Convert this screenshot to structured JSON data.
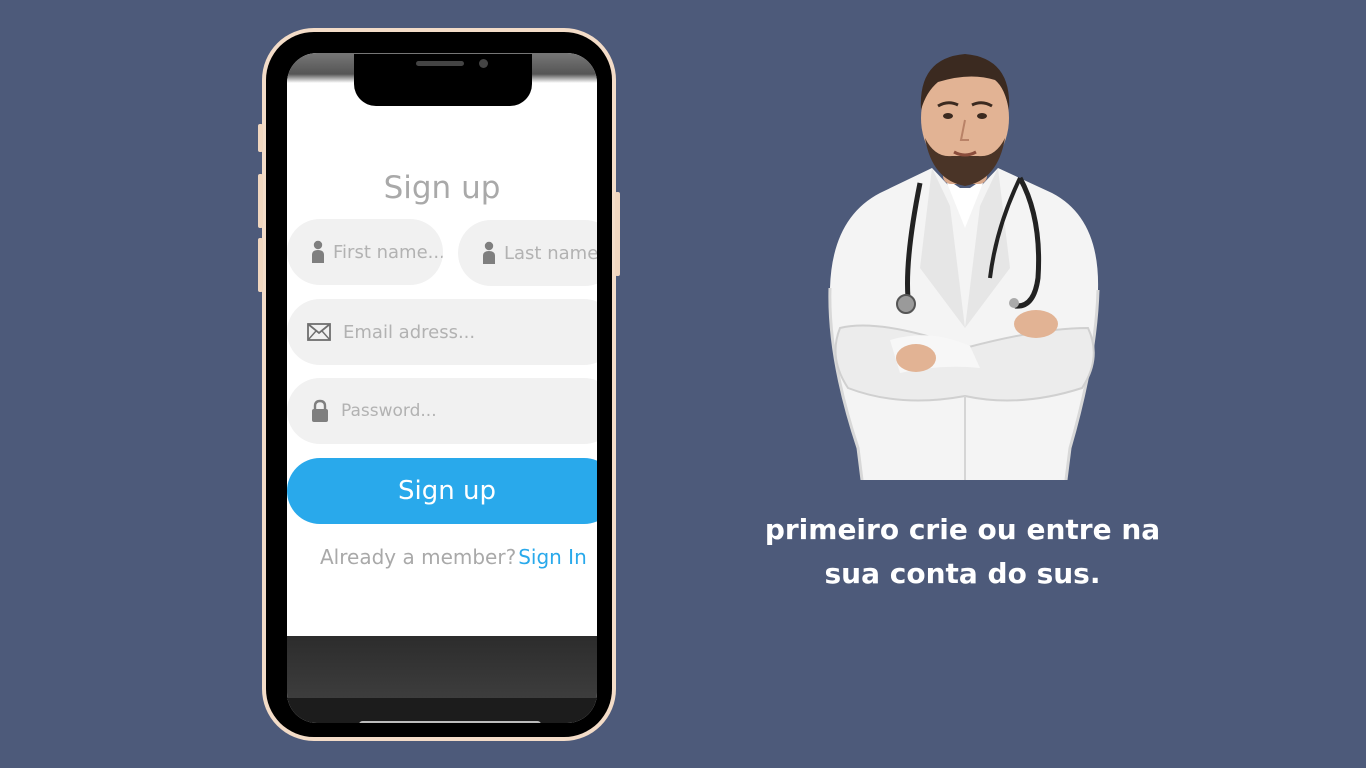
{
  "colors": {
    "background": "#4d5a7a",
    "accent": "#29a9eb",
    "phone_frame": "#f3dcc8",
    "field_bg": "#f1f1f1"
  },
  "phone": {
    "form": {
      "title": "Sign up",
      "first_name_placeholder": "First name...",
      "last_name_placeholder": "Last name...",
      "email_placeholder": "Email adress...",
      "password_placeholder": "Password...",
      "submit_label": "Sign up",
      "member_text": "Already a member?",
      "signin_link": "Sign In"
    },
    "icons": {
      "first_name": "user-icon",
      "last_name": "user-icon",
      "email": "envelope-icon",
      "password": "lock-icon"
    }
  },
  "promo": {
    "image": "doctor-photo",
    "caption_line1": "primeiro crie ou entre na",
    "caption_line2": "sua conta do sus."
  }
}
